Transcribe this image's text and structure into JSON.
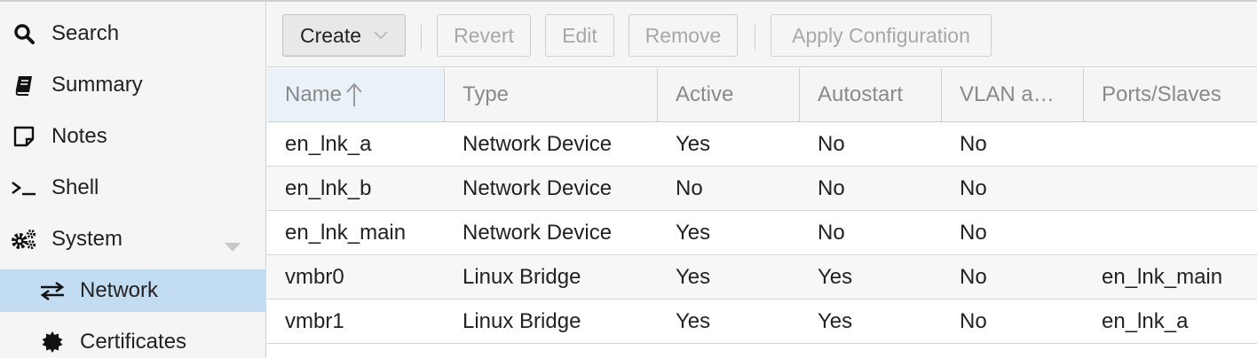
{
  "sidebar": {
    "items": [
      {
        "label": "Search",
        "icon": "search-icon"
      },
      {
        "label": "Summary",
        "icon": "book-icon"
      },
      {
        "label": "Notes",
        "icon": "note-icon"
      },
      {
        "label": "Shell",
        "icon": "terminal-icon"
      },
      {
        "label": "System",
        "icon": "gears-icon"
      },
      {
        "label": "Network",
        "icon": "exchange-icon"
      },
      {
        "label": "Certificates",
        "icon": "certificate-icon"
      }
    ],
    "selected": "Network"
  },
  "toolbar": {
    "create_label": "Create",
    "revert_label": "Revert",
    "edit_label": "Edit",
    "remove_label": "Remove",
    "apply_label": "Apply Configuration"
  },
  "table": {
    "columns": [
      "Name",
      "Type",
      "Active",
      "Autostart",
      "VLAN a…",
      "Ports/Slaves"
    ],
    "sort_column": "Name",
    "sort_direction": "ascending",
    "rows": [
      [
        "en_lnk_a",
        "Network Device",
        "Yes",
        "No",
        "No",
        ""
      ],
      [
        "en_lnk_b",
        "Network Device",
        "No",
        "No",
        "No",
        ""
      ],
      [
        "en_lnk_main",
        "Network Device",
        "Yes",
        "No",
        "No",
        ""
      ],
      [
        "vmbr0",
        "Linux Bridge",
        "Yes",
        "Yes",
        "No",
        "en_lnk_main"
      ],
      [
        "vmbr1",
        "Linux Bridge",
        "Yes",
        "Yes",
        "No",
        "en_lnk_a"
      ]
    ]
  },
  "colors": {
    "selected_bg": "#c2ddf2",
    "sorted_header_bg": "#e9f1f9",
    "panel_bg": "#f5f5f5",
    "border": "#cfcfcf"
  }
}
